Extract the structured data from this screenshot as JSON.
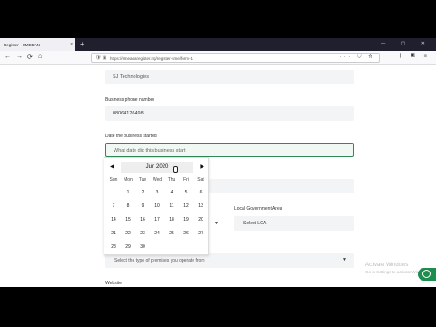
{
  "browser": {
    "tab_title": "Register - SMEDAN",
    "tab_close": "×",
    "new_tab": "+",
    "window_controls": "— ▢ ✕",
    "url": "https://smeaearegister.ng/register-sme/form-1",
    "nav": {
      "back": "←",
      "forward": "→",
      "reload": "⟳",
      "home": "⌂"
    },
    "url_icons": "🛡 ▣",
    "url_actions": "··· ⛉ ☆",
    "toolbar_icons": "⫼ ▣ ≡"
  },
  "form": {
    "company_name_value": "SJ Technologies",
    "phone_label": "Business phone number",
    "phone_value": "08064126498",
    "date_label": "Date the business started",
    "date_placeholder": "What date did this business start",
    "lga_label": "Local Government Area",
    "lga_select": "Select LGA",
    "premises_select": "Select the type of premises you operate from",
    "website_label": "Website"
  },
  "datepicker": {
    "month_label": "Jun 2020",
    "prev": "◀",
    "next": "▶",
    "weekdays": [
      "Sun",
      "Mon",
      "Tue",
      "Wed",
      "Thu",
      "Fri",
      "Sat"
    ],
    "weeks": [
      [
        "",
        "1",
        "2",
        "3",
        "4",
        "5",
        "6"
      ],
      [
        "7",
        "8",
        "9",
        "10",
        "11",
        "12",
        "13"
      ],
      [
        "14",
        "15",
        "16",
        "17",
        "18",
        "19",
        "20"
      ],
      [
        "21",
        "22",
        "23",
        "24",
        "25",
        "26",
        "27"
      ],
      [
        "28",
        "29",
        "30",
        "",
        "",
        "",
        ""
      ]
    ]
  },
  "overlay": {
    "activate_line1": "Activate Windows",
    "activate_line2": "Go to Settings to activate Windows."
  }
}
